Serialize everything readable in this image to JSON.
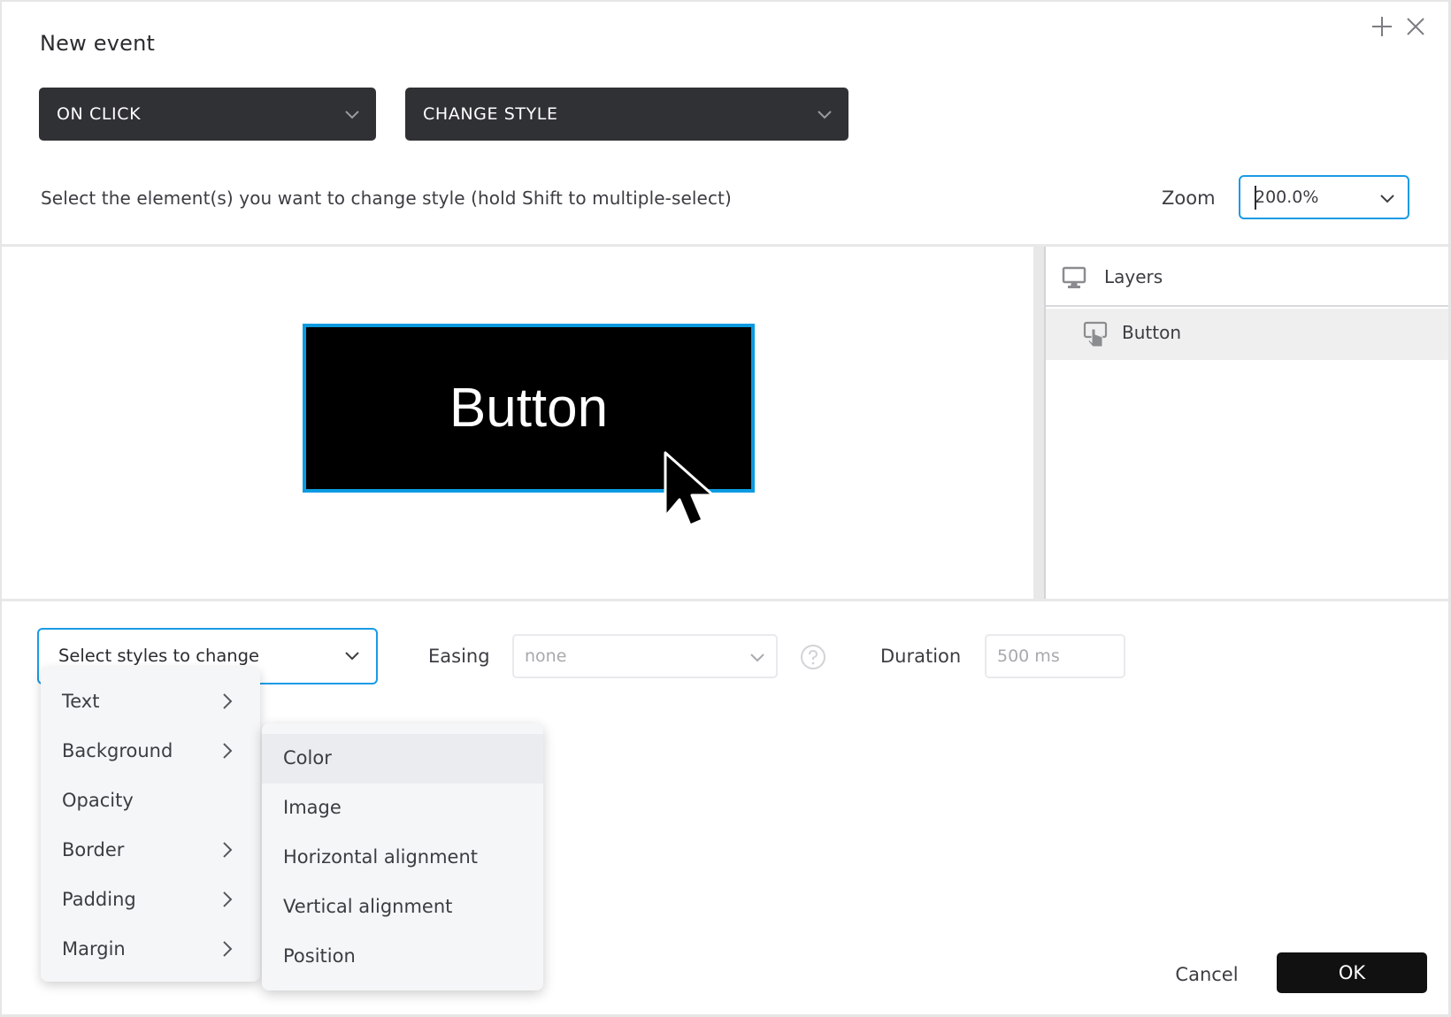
{
  "dialog": {
    "title": "New event",
    "header_icons": [
      "plus-icon",
      "close-icon"
    ]
  },
  "trigger_select": {
    "value": "ON CLICK"
  },
  "action_select": {
    "value": "CHANGE STYLE"
  },
  "instruction": "Select the element(s) you want to change style (hold Shift to multiple-select)",
  "zoom": {
    "label": "Zoom",
    "value": "200.0%"
  },
  "canvas": {
    "button_label": "Button",
    "accent_color": "#0a9ae0"
  },
  "layers": {
    "title": "Layers",
    "items": [
      {
        "label": "Button",
        "selected": true
      }
    ]
  },
  "styles_select": {
    "placeholder": "Select styles to change"
  },
  "easing": {
    "label": "Easing",
    "value": "none"
  },
  "duration": {
    "label": "Duration",
    "value": "500 ms"
  },
  "styles_menu": {
    "items": [
      {
        "label": "Text",
        "has_submenu": true
      },
      {
        "label": "Background",
        "has_submenu": true
      },
      {
        "label": "Opacity",
        "has_submenu": false
      },
      {
        "label": "Border",
        "has_submenu": true
      },
      {
        "label": "Padding",
        "has_submenu": true
      },
      {
        "label": "Margin",
        "has_submenu": true
      }
    ]
  },
  "background_submenu": {
    "items": [
      {
        "label": "Color",
        "highlighted": true
      },
      {
        "label": "Image",
        "highlighted": false
      },
      {
        "label": "Horizontal alignment",
        "highlighted": false
      },
      {
        "label": "Vertical alignment",
        "highlighted": false
      },
      {
        "label": "Position",
        "highlighted": false
      }
    ]
  },
  "footer": {
    "cancel_label": "Cancel",
    "ok_label": "OK"
  }
}
